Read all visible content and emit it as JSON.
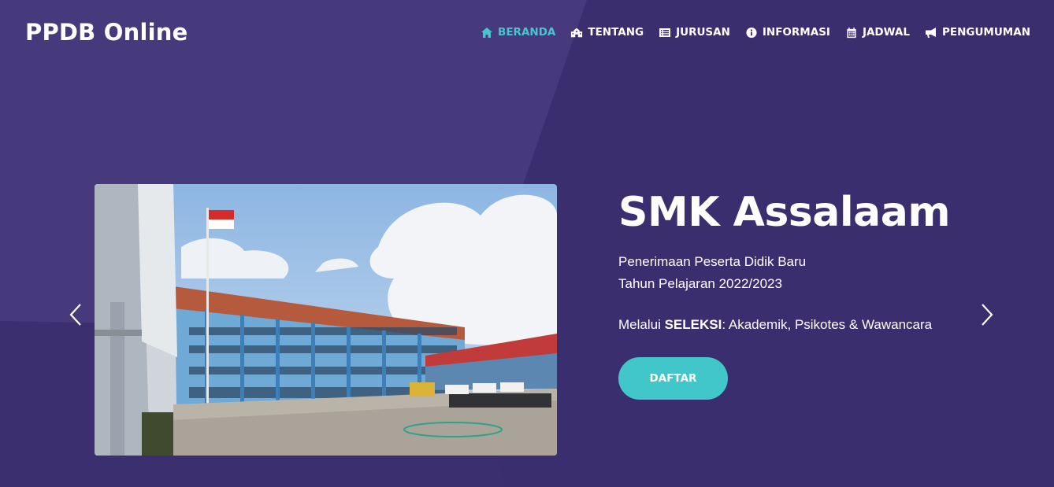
{
  "brand": "PPDB Online",
  "nav": [
    {
      "label": "BERANDA",
      "icon": "home-icon",
      "active": true
    },
    {
      "label": "TENTANG",
      "icon": "school-icon",
      "active": false
    },
    {
      "label": "JURUSAN",
      "icon": "list-icon",
      "active": false
    },
    {
      "label": "INFORMASI",
      "icon": "info-icon",
      "active": false
    },
    {
      "label": "JADWAL",
      "icon": "calendar-icon",
      "active": false
    },
    {
      "label": "PENGUMUMAN",
      "icon": "megaphone-icon",
      "active": false
    }
  ],
  "hero": {
    "title": "SMK Assalaam",
    "subtitle_line1": "Penerimaan Peserta Didik Baru",
    "subtitle_line2": "Tahun Pelajaran 2022/2023",
    "method_prefix": "Melalui ",
    "method_bold": "SELEKSI",
    "method_suffix": ": Akademik, Psikotes & Wawancara",
    "cta_label": "DAFTAR"
  },
  "carousel": {
    "prev_icon": "chevron-left-icon",
    "next_icon": "chevron-right-icon",
    "image": "school-building-photo"
  },
  "colors": {
    "background": "#3b2e6e",
    "accent": "#41c7c9",
    "active_nav": "#45c6cf"
  }
}
